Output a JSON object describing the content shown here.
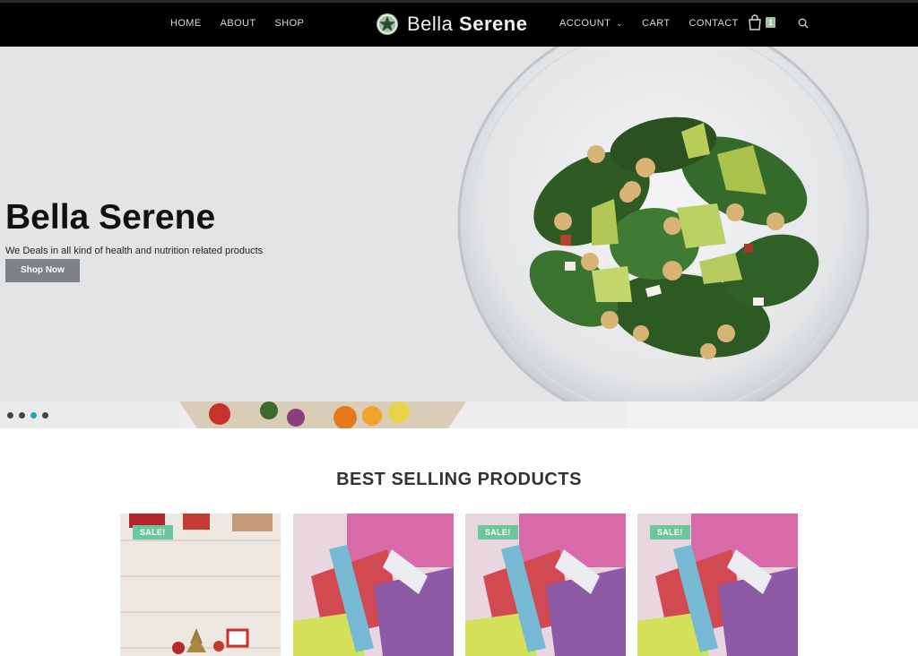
{
  "header": {
    "nav_left": [
      {
        "label": "HOME"
      },
      {
        "label": "ABOUT"
      },
      {
        "label": "SHOP"
      }
    ],
    "logo": {
      "text_light": "Bella ",
      "text_bold": "Serene"
    },
    "nav_right": [
      {
        "label": "ACCOUNT"
      },
      {
        "label": "CART"
      },
      {
        "label": "CONTACT"
      }
    ],
    "cart_count": "1"
  },
  "hero": {
    "title": "Bella Serene",
    "subtitle": "We Deals in all kind of health and nutrition related products",
    "button_label": "Shop Now",
    "slides": 4,
    "active_slide": 3
  },
  "best_selling": {
    "title": "BEST SELLING PRODUCTS",
    "products": [
      {
        "badge": "SALE!"
      },
      {
        "badge": ""
      },
      {
        "badge": "SALE!"
      },
      {
        "badge": "SALE!"
      }
    ]
  },
  "colors": {
    "header_bg": "#000000",
    "hero_bg": "#e4e4e6",
    "accent_dot": "#1aa7b5",
    "sale_badge": "#6cc79a",
    "button_bg": "#7d8284"
  }
}
